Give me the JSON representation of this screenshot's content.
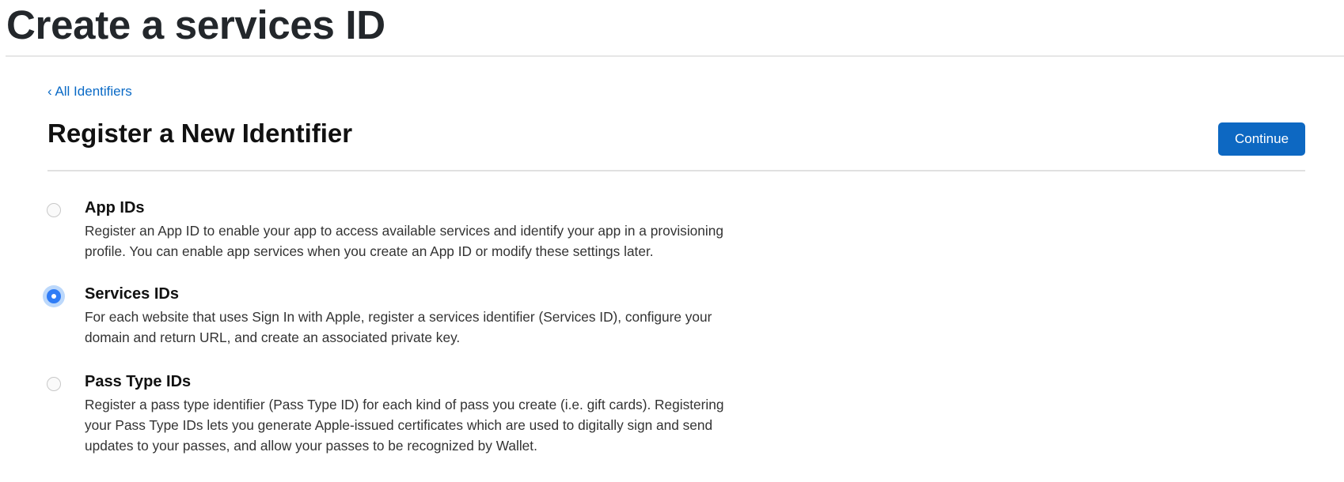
{
  "page_title": "Create a services ID",
  "back_link": "‹ All Identifiers",
  "section_title": "Register a New Identifier",
  "continue_label": "Continue",
  "colors": {
    "accent": "#0d68c2",
    "link": "#0a6ac6",
    "radio_selected": "#2f7cf6"
  },
  "options": [
    {
      "label": "App IDs",
      "selected": false,
      "description": [
        "Register an App ID to enable your app to access available services and identify your app in a provisioning",
        "profile. You can enable app services when you create an App ID or modify these settings later."
      ]
    },
    {
      "label": "Services IDs",
      "selected": true,
      "description": [
        "For each website that uses Sign In with Apple, register a services identifier (Services ID), configure your",
        "domain and return URL, and create an associated private key."
      ]
    },
    {
      "label": "Pass Type IDs",
      "selected": false,
      "description": [
        "Register a pass type identifier (Pass Type ID) for each kind of pass you create (i.e. gift cards). Registering",
        "your Pass Type IDs lets you generate Apple-issued certificates which are used to digitally sign and send",
        "updates to your passes, and allow your passes to be recognized by Wallet."
      ]
    }
  ]
}
